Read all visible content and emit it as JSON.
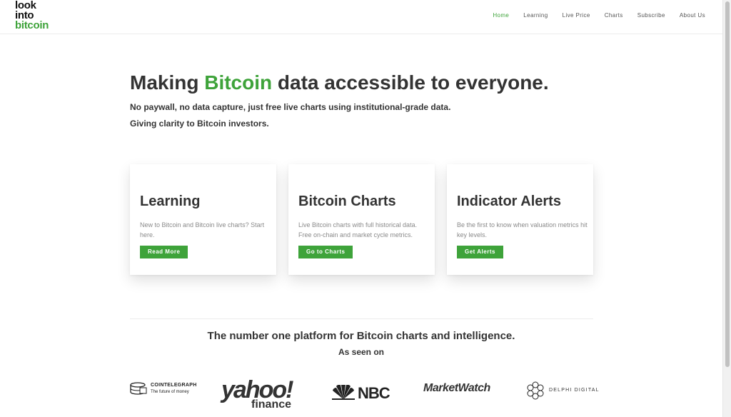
{
  "header": {
    "logo": {
      "line1": "look",
      "line2": "into",
      "line3": "bitcoin"
    },
    "nav": [
      {
        "label": "Home",
        "active": true
      },
      {
        "label": "Learning",
        "active": false
      },
      {
        "label": "Live Price",
        "active": false
      },
      {
        "label": "Charts",
        "active": false
      },
      {
        "label": "Subscribe",
        "active": false
      },
      {
        "label": "About Us",
        "active": false
      }
    ]
  },
  "hero": {
    "title_before": "Making ",
    "title_highlight": "Bitcoin",
    "title_after": " data accessible to everyone.",
    "subtitle1": "No paywall, no data capture, just free live charts using institutional-grade data.",
    "subtitle2": "Giving clarity to Bitcoin investors."
  },
  "cards": [
    {
      "title": "Learning",
      "text": "New to Bitcoin and Bitcoin live charts? Start here.",
      "button": "Read More"
    },
    {
      "title": "Bitcoin Charts",
      "text": "Live Bitcoin charts with full historical data. Free on-chain and market cycle metrics.",
      "button": "Go to Charts"
    },
    {
      "title": "Indicator Alerts",
      "text": "Be the first to know when valuation metrics hit key levels.",
      "button": "Get Alerts"
    }
  ],
  "platform": {
    "headline": "The number one platform for Bitcoin charts and intelligence.",
    "as_seen_on": "As seen on"
  },
  "press_logos": {
    "cointelegraph_name": "COINTELEGRAPH",
    "cointelegraph_tagline": "The future of money",
    "yahoo_word": "yahoo!",
    "yahoo_sub": "finance",
    "nbc": "NBC",
    "marketwatch": "MarketWatch",
    "delphi": "DELPHI DIGITAL"
  },
  "colors": {
    "accent": "#3ea33a",
    "text": "#333333",
    "muted": "#8a8a8a"
  }
}
